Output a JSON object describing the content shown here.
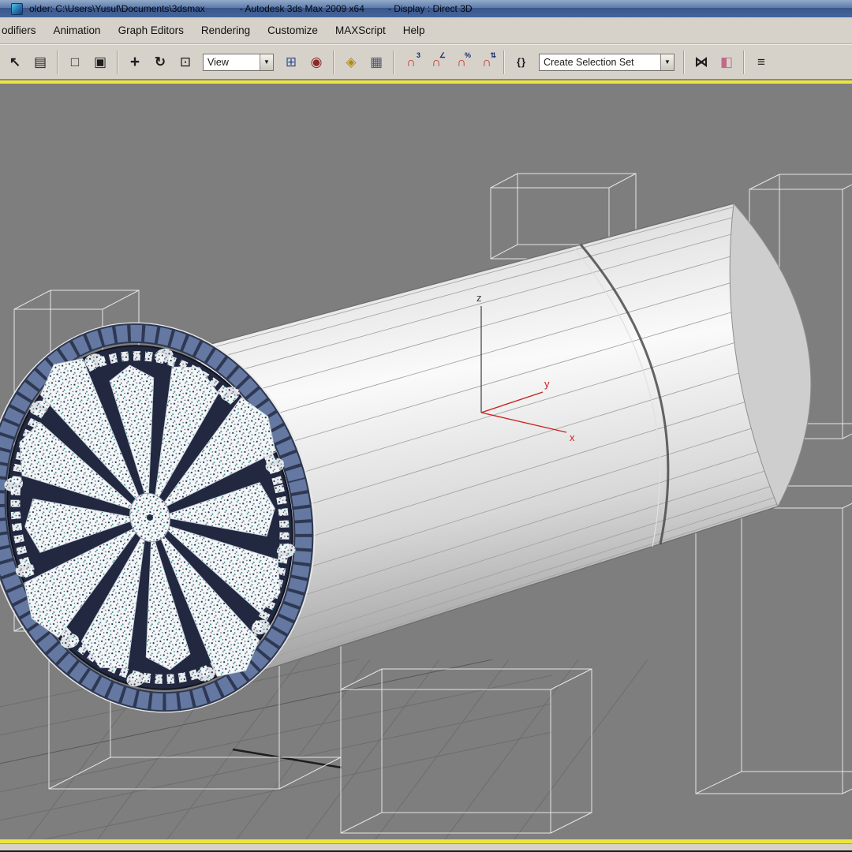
{
  "window": {
    "app_icon": "3ds-max-logo",
    "title_path": "older: C:\\Users\\Yusuf\\Documents\\3dsmax",
    "title_app": "- Autodesk 3ds Max  2009 x64",
    "title_display": "- Display : Direct 3D"
  },
  "menu": {
    "items": [
      {
        "label": "odifiers"
      },
      {
        "label": "Animation"
      },
      {
        "label": "Graph Editors"
      },
      {
        "label": "Rendering"
      },
      {
        "label": "Customize"
      },
      {
        "label": "MAXScript"
      },
      {
        "label": "Help"
      }
    ]
  },
  "toolbar": {
    "dropdown_arrow": "▼",
    "view_dropdown": {
      "value": "View"
    },
    "selection_set_dropdown": {
      "value": "Create Selection Set"
    },
    "icons": [
      {
        "name": "select-object",
        "glyph": "↖"
      },
      {
        "name": "select-by-name",
        "glyph": "▤"
      },
      {
        "name": "rectangular-selection-region",
        "glyph": "□"
      },
      {
        "name": "window-crossing-toggle",
        "glyph": "▣"
      },
      {
        "name": "select-and-move",
        "glyph": "+"
      },
      {
        "name": "select-and-rotate",
        "glyph": "↻"
      },
      {
        "name": "select-and-scale",
        "glyph": "⊡"
      },
      {
        "name": "reference-coordinate-system",
        "glyph": "⊞"
      },
      {
        "name": "use-pivot-point-center",
        "glyph": "◉"
      },
      {
        "name": "select-and-manipulate",
        "glyph": "◈"
      },
      {
        "name": "snaps-cube",
        "glyph": "▦"
      },
      {
        "name": "snaps-toggle-3d",
        "glyph": "∩",
        "sup": "3"
      },
      {
        "name": "angle-snap-toggle",
        "glyph": "∩",
        "sup": "∠"
      },
      {
        "name": "percent-snap-toggle",
        "glyph": "∩",
        "sup": "%"
      },
      {
        "name": "spinner-snap-toggle",
        "glyph": "∩",
        "sup": "⇅"
      },
      {
        "name": "named-selection-sets",
        "glyph": "{}"
      },
      {
        "name": "mirror",
        "glyph": "⋈"
      },
      {
        "name": "align",
        "glyph": "◧"
      },
      {
        "name": "layer-manager",
        "glyph": "≡"
      }
    ]
  },
  "viewport": {
    "axis": {
      "x": "x",
      "y": "y",
      "z": "z"
    },
    "colors": {
      "background": "#7e7e7e",
      "active_border": "#ece63c",
      "axis": "#cc2222",
      "cutter_face": "#222840",
      "brick_ring": "#6478a2"
    }
  }
}
